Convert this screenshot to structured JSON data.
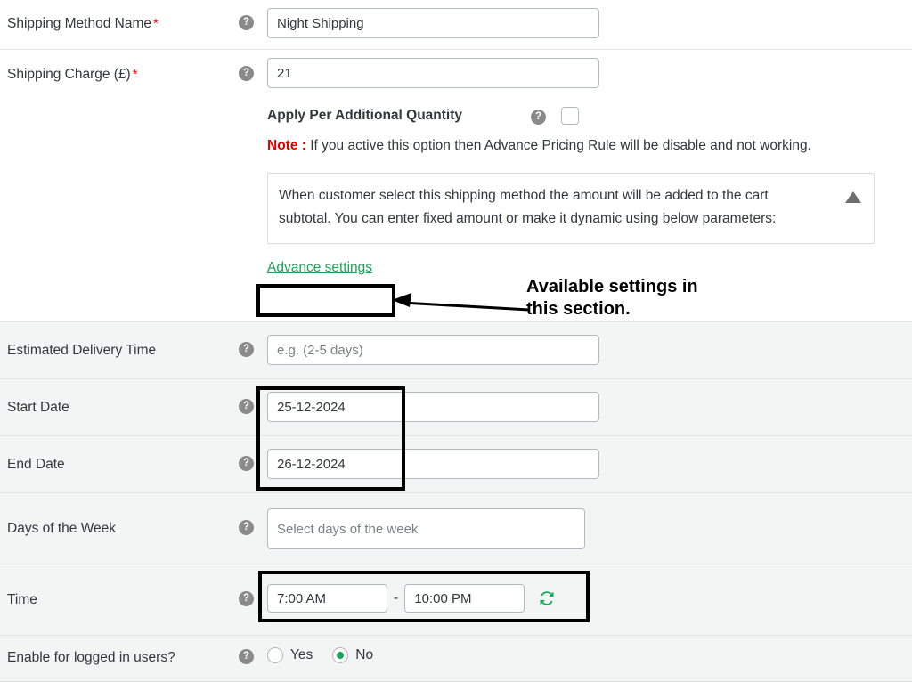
{
  "rows": [
    {
      "label": "Shipping Method Name",
      "required": true,
      "help_icon": "help-circle-icon",
      "value": "Night Shipping",
      "placeholder": ""
    },
    {
      "label": "Shipping Charge (£)",
      "required": true,
      "help_icon": "help-circle-icon",
      "value": "21",
      "placeholder": ""
    },
    {
      "label": "Estimated Delivery Time",
      "required": false,
      "help_icon": "help-circle-icon",
      "value": "",
      "placeholder": "e.g. (2-5 days)"
    },
    {
      "label": "Start Date",
      "required": false,
      "help_icon": "help-circle-icon",
      "value": "25-12-2024",
      "placeholder": ""
    },
    {
      "label": "End Date",
      "required": false,
      "help_icon": "help-circle-icon",
      "value": "26-12-2024",
      "placeholder": ""
    },
    {
      "label": "Days of the Week",
      "required": false,
      "help_icon": "help-circle-icon",
      "value": "",
      "placeholder": "Select days of the week"
    },
    {
      "label": "Time",
      "required": false,
      "help_icon": "help-circle-icon"
    },
    {
      "label": "Enable for logged in users?",
      "required": false,
      "help_icon": "help-circle-icon"
    }
  ],
  "apply_per_qty": {
    "label": "Apply Per Additional Quantity",
    "help_icon": "help-circle-icon",
    "checkbox_checked": false,
    "note_prefix": "Note :",
    "note_text": "If you active this option then Advance Pricing Rule will be disable and not working.",
    "note_prefix_color": "#e00000"
  },
  "info_box": {
    "text": "When customer select this shipping method the amount will be added to the cart subtotal. You can enter fixed amount or make it dynamic using below parameters:",
    "collapse_icon": "caret-up-icon"
  },
  "advance_settings": {
    "label": "Advance settings",
    "color": "#1aa558"
  },
  "time_row": {
    "start_value": "7:00 AM",
    "end_value": "10:00 PM",
    "separator": "-",
    "refresh_icon": "refresh-icon",
    "refresh_color": "#1aa558"
  },
  "logged_in_users": {
    "yes_label": "Yes",
    "no_label": "No",
    "selected": "No",
    "accent_color": "#1aa558"
  },
  "annotations": {
    "callout_text_line1": "Available settings in",
    "callout_text_line2": "this section.",
    "highlight_color": "#000000"
  }
}
